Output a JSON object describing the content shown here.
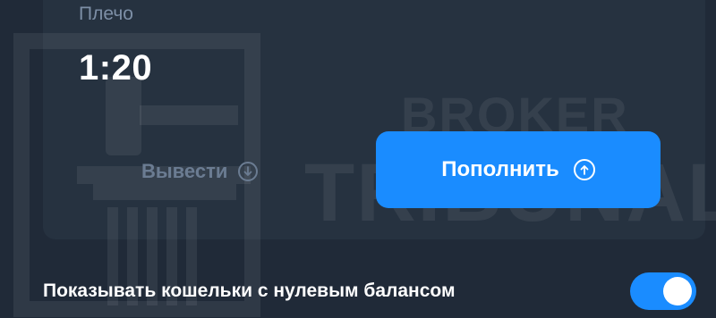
{
  "leverage": {
    "label": "Плечо",
    "value": "1:20"
  },
  "actions": {
    "withdraw_label": "Вывести",
    "withdraw_icon": "arrow-down-circle-icon",
    "deposit_label": "Пополнить",
    "deposit_icon": "arrow-up-circle-icon"
  },
  "settings": {
    "show_zero_balance_label": "Показывать кошельки с нулевым балансом",
    "show_zero_balance_enabled": true
  },
  "watermark": {
    "line1": "BROKER",
    "line2": "TRIBUNAL"
  },
  "colors": {
    "background": "#202a38",
    "accent": "#1a8cff",
    "muted_text": "#7d8fa6"
  }
}
